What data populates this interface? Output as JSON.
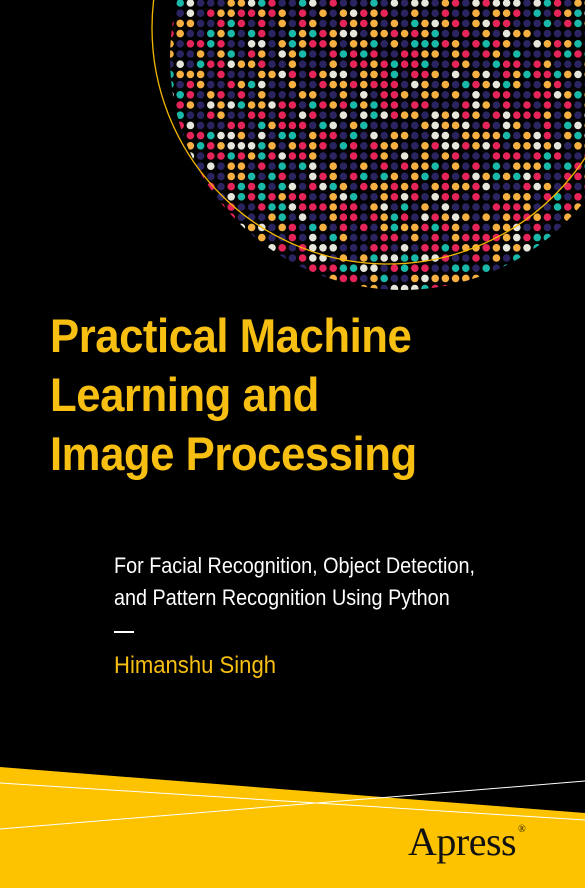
{
  "title_lines": [
    "Practical Machine",
    "Learning and",
    "Image Processing"
  ],
  "subtitle_lines": [
    "For Facial Recognition, Object Detection,",
    "and Pattern Recognition Using Python"
  ],
  "author": "Himanshu Singh",
  "publisher": {
    "name": "Apress",
    "mark": "®"
  },
  "colors": {
    "background": "#000000",
    "title": "#f7bf12",
    "band": "#fdc300",
    "dots": [
      "#2a2560",
      "#e5245a",
      "#f5b041",
      "#1ab8a8",
      "#e6e6dc"
    ]
  }
}
